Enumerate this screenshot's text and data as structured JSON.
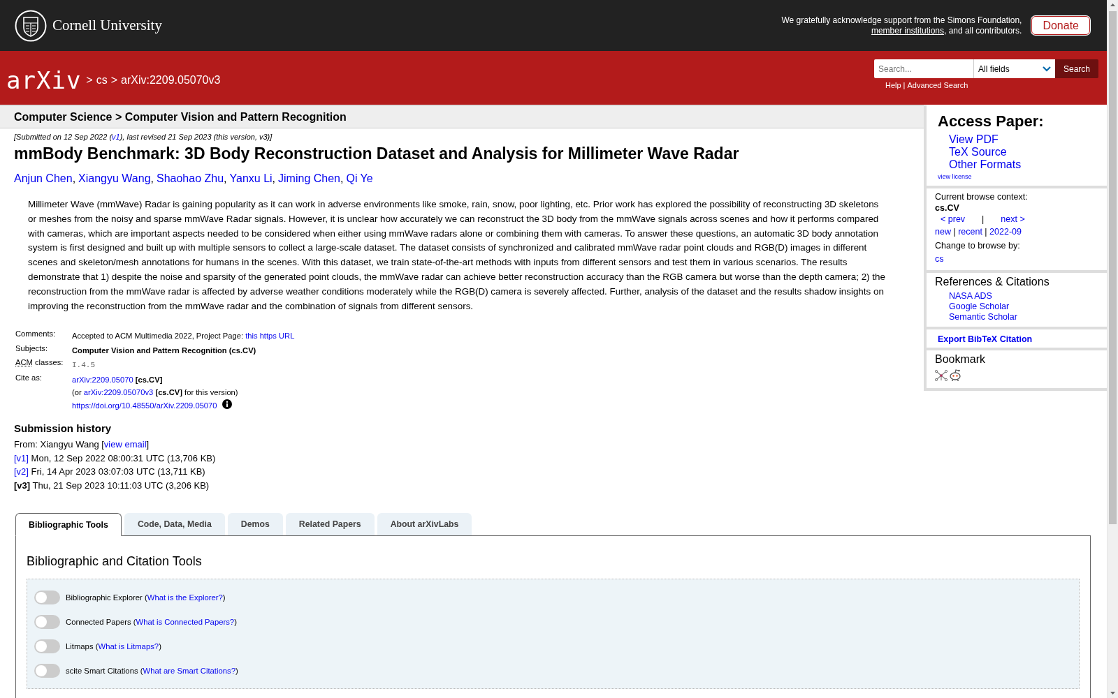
{
  "header": {
    "university": "Cornell University",
    "acknowledgement": [
      {
        "kind": "text",
        "text": "We gratefully acknowledge support from the Simons Foundation, "
      },
      {
        "kind": "ulink",
        "text": "member institutions"
      },
      {
        "kind": "text",
        "text": ", and all contributors."
      }
    ],
    "donate": "Donate"
  },
  "nav": {
    "logo": "arXiv",
    "breadcrumb": [
      {
        "sep": ">",
        "label": "cs"
      },
      {
        "sep": ">",
        "label": "arXiv:2209.05070v3"
      }
    ],
    "search": {
      "placeholder": "Search...",
      "field": "All fields",
      "button": "Search",
      "links": [
        "Help",
        "Advanced Search"
      ],
      "link_sep": "|"
    }
  },
  "subheader": "Computer Science > Computer Vision and Pattern Recognition",
  "dateline": [
    {
      "kind": "text",
      "text": "[Submitted on 12 Sep 2022 ("
    },
    {
      "kind": "link",
      "text": "v1"
    },
    {
      "kind": "text",
      "text": "), last revised 21 Sep 2023 (this version, v3)]"
    }
  ],
  "title": "mmBody Benchmark: 3D Body Reconstruction Dataset and Analysis for Millimeter Wave Radar",
  "authors": [
    {
      "name": "Anjun Chen",
      "sep": ","
    },
    {
      "name": "Xiangyu Wang",
      "sep": ","
    },
    {
      "name": "Shaohao Zhu",
      "sep": ","
    },
    {
      "name": "Yanxu Li",
      "sep": ","
    },
    {
      "name": "Jiming Chen",
      "sep": ","
    },
    {
      "name": "Qi Ye"
    }
  ],
  "abstract": "Millimeter Wave (mmWave) Radar is gaining popularity as it can work in adverse environments like smoke, rain, snow, poor lighting, etc. Prior work has explored the possibility of reconstructing 3D skeletons or meshes from the noisy and sparse mmWave Radar signals. However, it is unclear how accurately we can reconstruct the 3D body from the mmWave signals across scenes and how it performs compared with cameras, which are important aspects needed to be considered when either using mmWave radars alone or combining them with cameras. To answer these questions, an automatic 3D body annotation system is first designed and built up with multiple sensors to collect a large-scale dataset. The dataset consists of synchronized and calibrated mmWave radar point clouds and RGB(D) images in different scenes and skeleton/mesh annotations for humans in the scenes. With this dataset, we train state-of-the-art methods with inputs from different sensors and test them in various scenarios. The results demonstrate that 1) despite the noise and sparsity of the generated point clouds, the mmWave radar can achieve better reconstruction accuracy than the RGB camera but worse than the depth camera; 2) the reconstruction from the mmWave radar is affected by adverse weather conditions moderately while the RGB(D) camera is severely affected. Further, analysis of the dataset and the results shadow insights on improving the reconstruction from the mmWave radar and the combination of signals from different sensors.",
  "metadata": [
    {
      "label": [
        {
          "kind": "text",
          "text": "Comments:"
        }
      ],
      "lines": [
        [
          {
            "kind": "text",
            "text": "Accepted to ACM Multimedia 2022, Project Page: "
          },
          {
            "kind": "link",
            "text": "this https URL"
          }
        ]
      ]
    },
    {
      "label": [
        {
          "kind": "text",
          "text": "Subjects:"
        }
      ],
      "lines": [
        [
          {
            "kind": "bold",
            "text": "Computer Vision and Pattern Recognition (cs.CV)"
          }
        ]
      ]
    },
    {
      "label": [
        {
          "kind": "abbr",
          "text": "ACM"
        },
        {
          "kind": "text",
          "text": " classes:"
        }
      ],
      "lines": [
        [
          {
            "kind": "mono",
            "text": "I.4.5"
          }
        ]
      ]
    },
    {
      "label": [
        {
          "kind": "text",
          "text": "Cite as:"
        }
      ],
      "lines": [
        [
          {
            "kind": "link",
            "text": "arXiv:2209.05070"
          },
          {
            "kind": "bold",
            "text": " [cs.CV]"
          }
        ],
        [
          {
            "kind": "text",
            "text": "(or "
          },
          {
            "kind": "link",
            "text": "arXiv:2209.05070v3"
          },
          {
            "kind": "bold",
            "text": " [cs.CV]"
          },
          {
            "kind": "text",
            "text": " for this version)"
          }
        ],
        [
          {
            "kind": "link",
            "text": "https://doi.org/10.48550/arXiv.2209.05070"
          },
          {
            "kind": "info"
          }
        ]
      ]
    }
  ],
  "history": {
    "heading": "Submission history",
    "lines": [
      [
        {
          "kind": "text",
          "text": "From: Xiangyu Wang ["
        },
        {
          "kind": "link",
          "text": "view email"
        },
        {
          "kind": "text",
          "text": "]"
        }
      ],
      [
        {
          "kind": "link",
          "text": "[v1]"
        },
        {
          "kind": "text",
          "text": " Mon, 12 Sep 2022 08:00:31 UTC (13,706 KB)"
        }
      ],
      [
        {
          "kind": "link",
          "text": "[v2]"
        },
        {
          "kind": "text",
          "text": " Fri, 14 Apr 2023 03:07:03 UTC (13,711 KB)"
        }
      ],
      [
        {
          "kind": "bold",
          "text": "[v3]"
        },
        {
          "kind": "text",
          "text": " Thu, 21 Sep 2023 10:11:03 UTC (3,206 KB)"
        }
      ]
    ]
  },
  "tabs": [
    {
      "label": "Bibliographic Tools",
      "selected": true
    },
    {
      "label": "Code, Data, Media",
      "selected": false
    },
    {
      "label": "Demos",
      "selected": false
    },
    {
      "label": "Related Papers",
      "selected": false
    },
    {
      "label": "About arXivLabs",
      "selected": false
    }
  ],
  "tools": {
    "heading": "Bibliographic and Citation Tools",
    "items": [
      {
        "label": "Bibliographic Explorer (",
        "link": "What is the Explorer?",
        "close": ")",
        "on": false
      },
      {
        "label": "Connected Papers (",
        "link": "What is Connected Papers?",
        "close": ")",
        "on": false
      },
      {
        "label": "Litmaps (",
        "link": "What is Litmaps?",
        "close": ")",
        "on": false
      },
      {
        "label": "scite Smart Citations (",
        "link": "What are Smart Citations?",
        "close": ")",
        "on": false
      }
    ]
  },
  "sidebar": {
    "access": {
      "heading": "Access Paper:",
      "links": [
        "View PDF",
        "TeX Source",
        "Other Formats"
      ],
      "license": "view license"
    },
    "browse": {
      "label": "Current browse context:",
      "context": "cs.CV",
      "prev": "< prev",
      "sep": "|",
      "next": "next >",
      "lists": [
        {
          "kind": "link",
          "text": "new"
        },
        {
          "kind": "text",
          "text": " | "
        },
        {
          "kind": "link",
          "text": "recent"
        },
        {
          "kind": "text",
          "text": " | "
        },
        {
          "kind": "link",
          "text": "2022-09"
        }
      ],
      "change_label": "Change to browse by:",
      "change_links": [
        "cs"
      ]
    },
    "references": {
      "heading": "References & Citations",
      "links": [
        "NASA ADS",
        "Google Scholar",
        "Semantic Scholar"
      ]
    },
    "export": "Export BibTeX Citation",
    "bookmark": {
      "heading": "Bookmark"
    }
  }
}
